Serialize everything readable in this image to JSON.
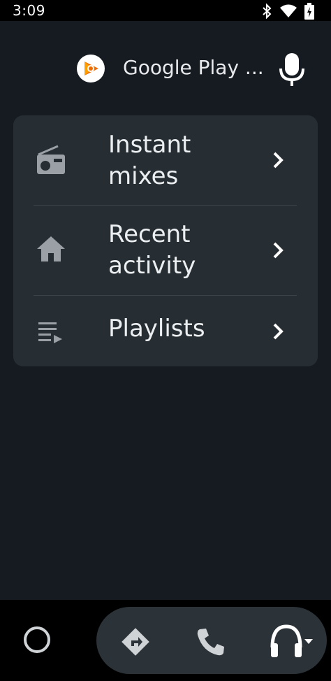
{
  "status": {
    "time": "3:09"
  },
  "header": {
    "app_title": "Google Play ..."
  },
  "menu": {
    "items": [
      {
        "label_line1": "Instant",
        "label_line2": "mixes",
        "icon": "radio-icon"
      },
      {
        "label_line1": "Recent",
        "label_line2": "activity",
        "icon": "home-icon"
      },
      {
        "label_line1": "Playlists",
        "icon": "playlist-icon"
      }
    ]
  },
  "colors": {
    "background": "#151b21",
    "card": "#262d33",
    "icon_gray": "#9aa0a6",
    "text": "#eceff1"
  }
}
